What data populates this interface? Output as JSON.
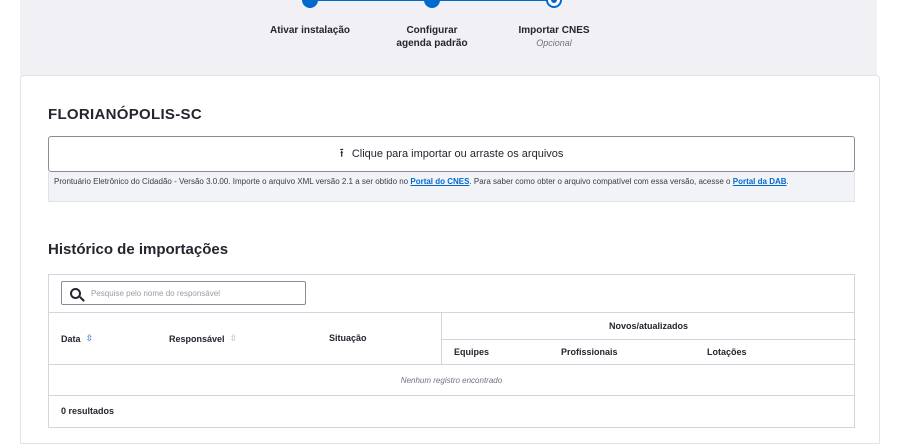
{
  "stepper": {
    "steps": [
      {
        "label": "Ativar instalação",
        "sub": "",
        "state": "done"
      },
      {
        "label": "Configurar agenda padrão",
        "sub": "",
        "state": "done"
      },
      {
        "label": "Importar CNES",
        "sub": "Opcional",
        "state": "current"
      }
    ],
    "accent": "#0069d0"
  },
  "card": {
    "city": "FLORIANÓPOLIS-SC",
    "upload_label": "Clique para importar ou arraste os arquivos",
    "info": {
      "text_1": "Prontuário Eletrônico do Cidadão - Versão 3.0.00. Importe o arquivo XML versão 2.1 a ser obtido no ",
      "link_cnes": "Portal do CNES",
      "text_2": ". Para saber como obter o arquivo compatível com essa versão, acesse o ",
      "link_dab": "Portal da DAB",
      "text_3": "."
    }
  },
  "history": {
    "title": "Histórico de importações",
    "search_placeholder": "Pesquise pelo nome do responsável",
    "columns": {
      "data": "Data",
      "responsavel": "Responsável",
      "situacao": "Situação",
      "group": "Novos/atualizados",
      "equipes": "Equipes",
      "profissionais": "Profissionais",
      "lotacoes": "Lotações"
    },
    "empty_message": "Nenhum registro encontrado",
    "results": "0 resultados"
  }
}
